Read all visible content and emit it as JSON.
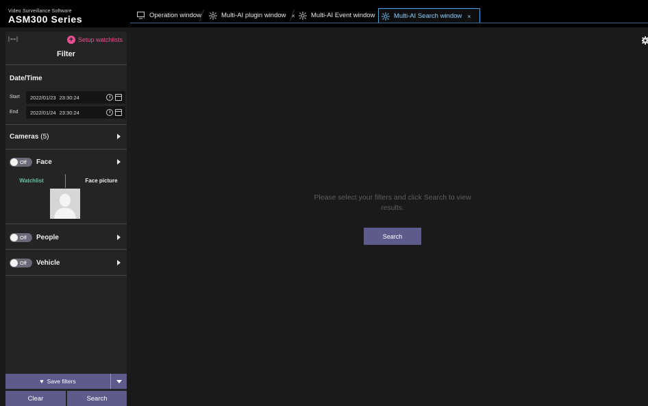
{
  "app": {
    "subtitle": "Video Surveillance Software",
    "title": "ASM300 Series"
  },
  "tabs": [
    {
      "label": "Operation window",
      "icon": "monitor-icon",
      "closable": false,
      "active": false
    },
    {
      "label": "Multi-AI plugin window",
      "icon": "ai-icon",
      "close": "×",
      "active": false
    },
    {
      "label": "Multi-AI Event window",
      "icon": "ai-icon",
      "close": "×",
      "active": false
    },
    {
      "label": "Multi-AI Search window",
      "icon": "ai-icon",
      "close": "×",
      "active": true
    }
  ],
  "sidebar": {
    "setup_label": "Setup watchlists",
    "filter_title": "Filter",
    "datetime": {
      "heading": "Date/Time",
      "start_label": "Start",
      "start_value": "2022/01/23  23:30:24",
      "end_label": "End",
      "end_value": "2022/01/24  23:30:24"
    },
    "cameras": {
      "label": "Cameras",
      "count": "(5)"
    },
    "face": {
      "label": "Face",
      "toggle": "Off",
      "tab_watchlist": "Watchlist",
      "tab_face_picture": "Face picture"
    },
    "people": {
      "label": "People",
      "toggle": "Off"
    },
    "vehicle": {
      "label": "Vehicle",
      "toggle": "Off"
    },
    "save_filters": "Save filters",
    "clear": "Clear",
    "search": "Search"
  },
  "main": {
    "prompt": "Please select your filters and click Search to view results.",
    "search": "Search"
  },
  "colors": {
    "accent": "#5d5a8c",
    "setup_pink": "#e8508f",
    "active_tab": "#8fd1ff",
    "watchlist_green": "#66c2a5"
  }
}
